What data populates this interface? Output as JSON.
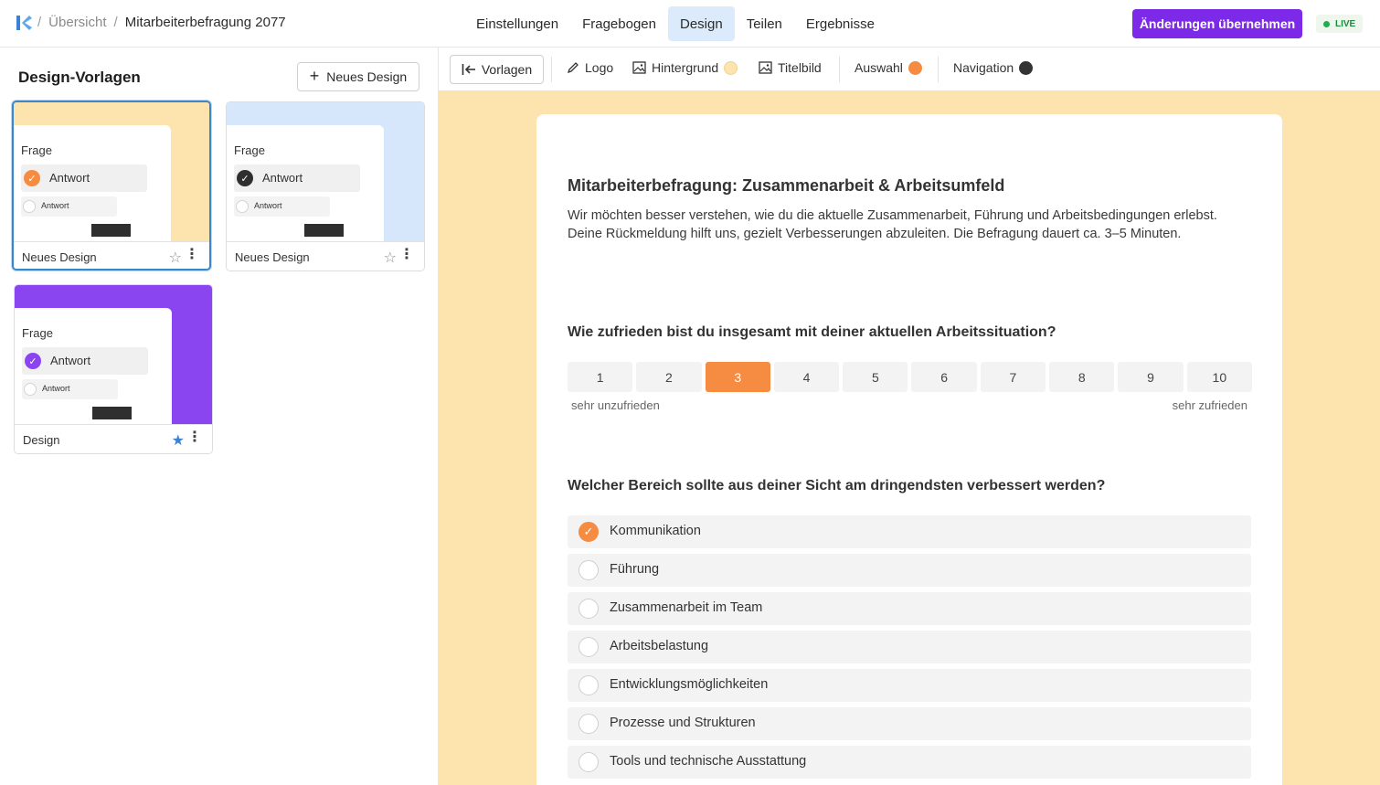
{
  "header": {
    "breadcrumb": {
      "sep": "/",
      "overview": "Übersicht",
      "current": "Mitarbeiterbefragung 2077"
    },
    "tabs": [
      "Einstellungen",
      "Fragebogen",
      "Design",
      "Teilen",
      "Ergebnisse"
    ],
    "active_tab": "Design",
    "apply_label": "Änderungen übernehmen",
    "live_label": "LIVE"
  },
  "sidebar": {
    "title": "Design-Vorlagen",
    "new_design_label": "Neues Design",
    "templates": [
      {
        "name": "Neues Design",
        "question": "Frage",
        "answer": "Antwort",
        "answer_small": "Antwort",
        "bg_color": "#fde3ad",
        "accent": "#f58c42",
        "favorite": false,
        "selected": true
      },
      {
        "name": "Neues Design",
        "question": "Frage",
        "answer": "Antwort",
        "answer_small": "Antwort",
        "bg_color": "#d6e6fb",
        "accent": "#2f2f2f",
        "favorite": false,
        "selected": false
      },
      {
        "name": "Design",
        "question": "Frage",
        "answer": "Antwort",
        "answer_small": "Antwort",
        "bg_color": "#8b45f0",
        "accent": "#8b45f0",
        "favorite": true,
        "selected": false
      }
    ]
  },
  "toolbar": {
    "back_label": "Vorlagen",
    "logo_label": "Logo",
    "background_label": "Hintergrund",
    "background_color": "#fde3ad",
    "title_image_label": "Titelbild",
    "selection_label": "Auswahl",
    "selection_color": "#f58c42",
    "navigation_label": "Navigation",
    "navigation_color": "#333333"
  },
  "survey": {
    "title": "Mitarbeiterbefragung: Zusammenarbeit & Arbeitsumfeld",
    "description": "Wir möchten besser verstehen, wie du die aktuelle Zusammenarbeit, Führung und Arbeitsbedingungen erlebst. Deine Rückmeldung hilft uns, gezielt Verbesserungen abzuleiten. Die Befragung dauert ca. 3–5 Minuten.",
    "q1": {
      "title": "Wie zufrieden bist du insgesamt mit deiner aktuellen Arbeitssituation?",
      "scale": [
        "1",
        "2",
        "3",
        "4",
        "5",
        "6",
        "7",
        "8",
        "9",
        "10"
      ],
      "selected": "3",
      "low_label": "sehr unzufrieden",
      "high_label": "sehr zufrieden"
    },
    "q2": {
      "title": "Welcher Bereich sollte aus deiner Sicht am dringendsten verbessert werden?",
      "options": [
        {
          "label": "Kommunikation",
          "checked": true
        },
        {
          "label": "Führung",
          "checked": false
        },
        {
          "label": "Zusammenarbeit im Team",
          "checked": false
        },
        {
          "label": "Arbeitsbelastung",
          "checked": false
        },
        {
          "label": "Entwicklungsmöglichkeiten",
          "checked": false
        },
        {
          "label": "Prozesse und Strukturen",
          "checked": false
        },
        {
          "label": "Tools und technische Ausstattung",
          "checked": false
        }
      ]
    }
  }
}
